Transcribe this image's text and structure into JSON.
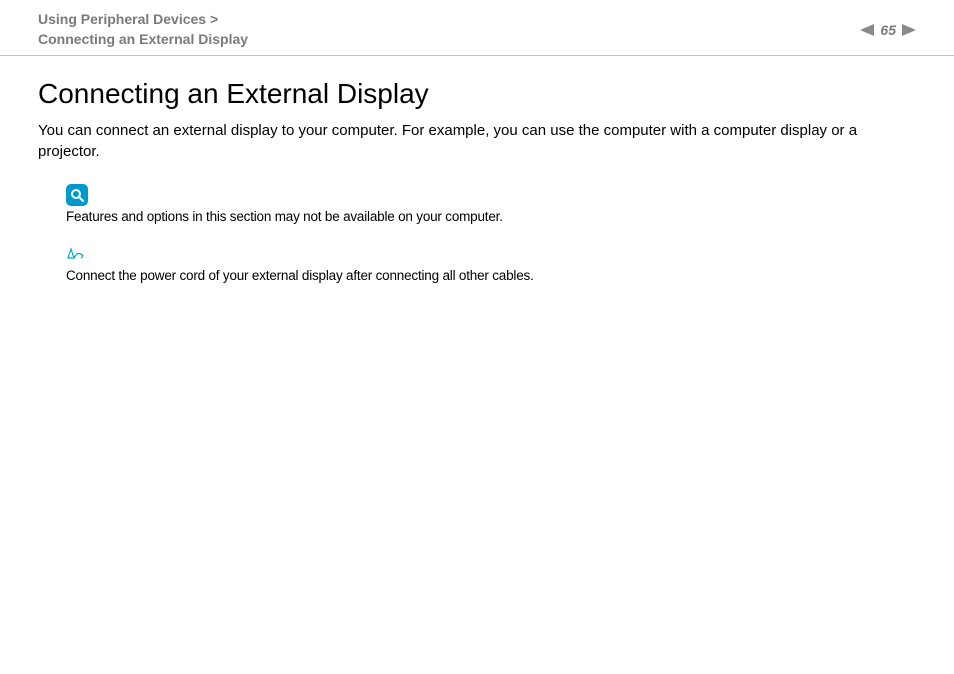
{
  "header": {
    "breadcrumb_parent": "Using Peripheral Devices",
    "breadcrumb_sep": ">",
    "breadcrumb_current": "Connecting an External Display",
    "page_number": "65"
  },
  "content": {
    "title": "Connecting an External Display",
    "intro": "You can connect an external display to your computer. For example, you can use the computer with a computer display or a projector.",
    "note1": "Features and options in this section may not be available on your computer.",
    "note2": "Connect the power cord of your external display after connecting all other cables."
  }
}
